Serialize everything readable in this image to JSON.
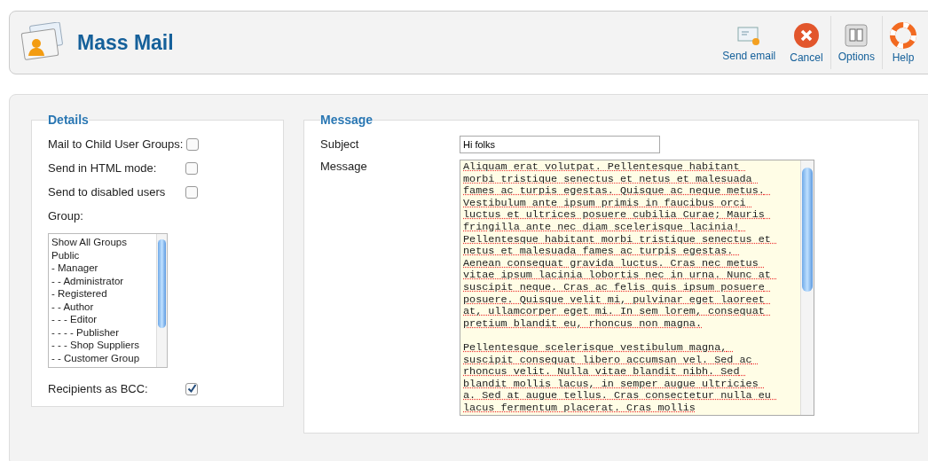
{
  "header": {
    "title": "Mass Mail"
  },
  "toolbar": [
    {
      "kind": "send",
      "label": "Send email"
    },
    {
      "kind": "cancel",
      "label": "Cancel"
    },
    {
      "kind": "options",
      "label": "Options"
    },
    {
      "kind": "help",
      "label": "Help"
    }
  ],
  "details": {
    "legend": "Details",
    "options": [
      {
        "label": "Mail to Child User Groups:",
        "checked": false
      },
      {
        "label": "Send in HTML mode:",
        "checked": false
      },
      {
        "label": "Send to disabled users",
        "checked": false
      }
    ],
    "group_label": "Group:",
    "groups": [
      {
        "label": "Show All Groups"
      },
      {
        "label": "Public",
        "children": [
          {
            "label": "- Manager",
            "children": [
              {
                "label": "- - Administrator"
              }
            ]
          },
          {
            "label": "- Registered",
            "children": [
              {
                "label": "- - Author",
                "children": [
                  {
                    "label": "- - - Editor",
                    "children": [
                      {
                        "label": "- - - - Publisher"
                      }
                    ]
                  },
                  {
                    "label": "- - - Shop Suppliers"
                  }
                ]
              },
              {
                "label": "- - Customer Group"
              }
            ]
          }
        ]
      }
    ],
    "bcc": {
      "label": "Recipients as BCC:",
      "checked": true
    }
  },
  "message": {
    "legend": "Message",
    "subject_label": "Subject",
    "subject": "Hi folks",
    "message_label": "Message",
    "body": "Aliquam erat volutpat. Pellentesque habitant morbi tristique senectus et netus et malesuada fames ac turpis egestas. Quisque ac neque metus. Vestibulum ante ipsum primis in faucibus orci luctus et ultrices posuere cubilia Curae; Mauris fringilla ante nec diam scelerisque lacinia! Pellentesque habitant morbi tristique senectus et netus et malesuada fames ac turpis egestas. Aenean consequat gravida luctus. Cras nec metus vitae ipsum lacinia lobortis nec in urna. Nunc at suscipit neque. Cras ac felis quis ipsum posuere posuere. Quisque velit mi, pulvinar eget laoreet at, ullamcorper eget mi. In sem lorem, consequat pretium blandit eu, rhoncus non magna.\n\nPellentesque scelerisque vestibulum magna, suscipit consequat libero accumsan vel. Sed ac rhoncus velit. Nulla vitae blandit nibh. Sed blandit mollis lacus, in semper augue ultricies a. Sed at augue tellus. Cras consectetur nulla eu lacus fermentum placerat. Cras mollis"
  }
}
